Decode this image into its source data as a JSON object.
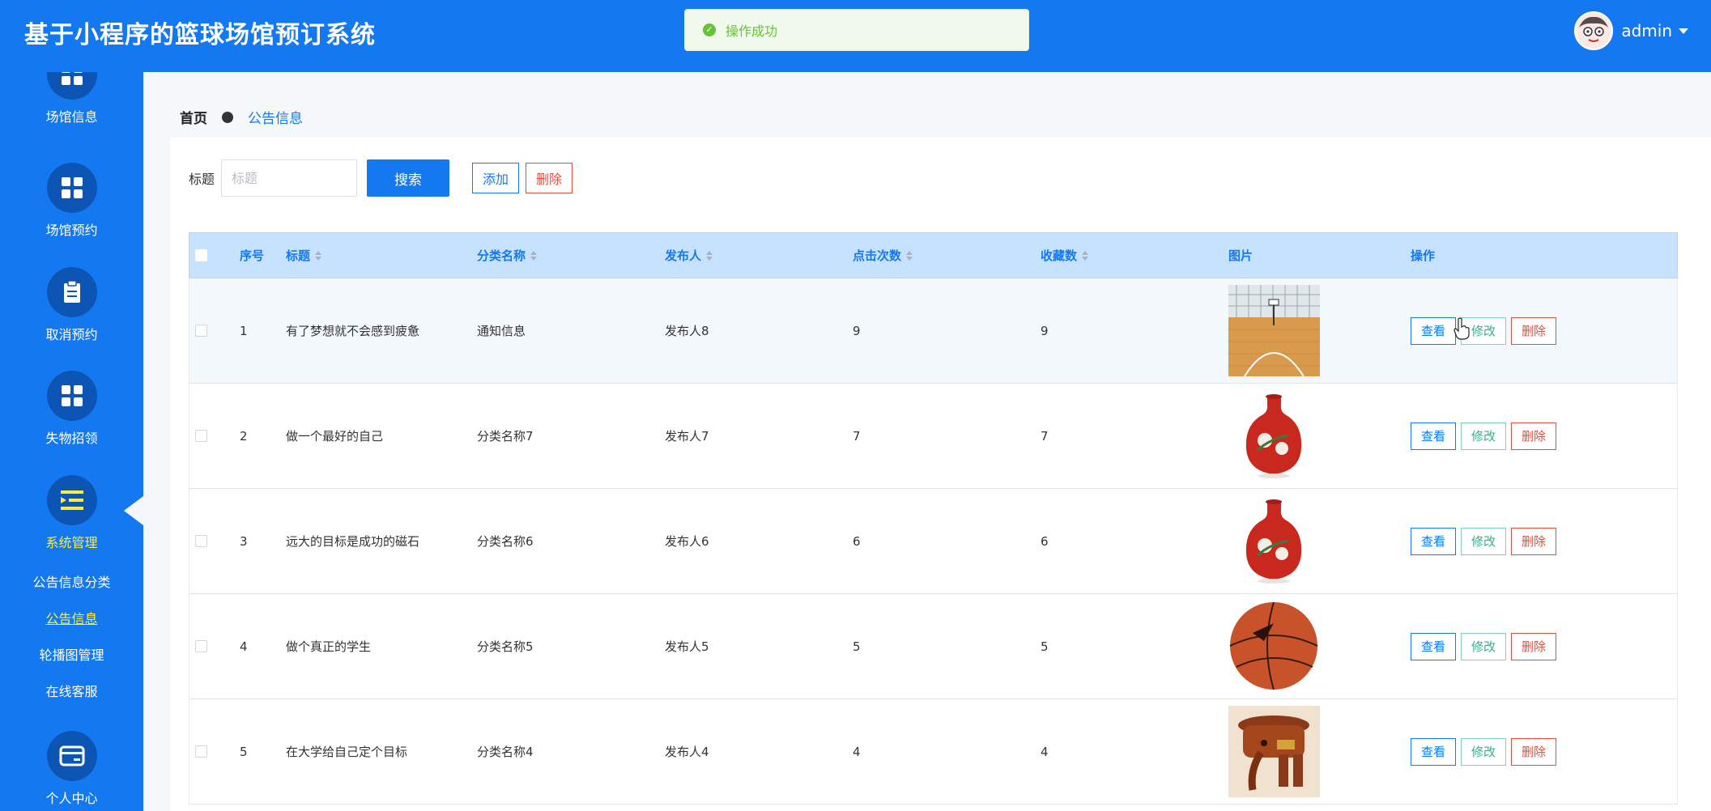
{
  "header": {
    "title": "基于小程序的篮球场馆预订系统",
    "toast": "操作成功",
    "user": "admin"
  },
  "sidebar": {
    "items": [
      {
        "label": "场馆信息",
        "icon": "grid-icon"
      },
      {
        "label": "场馆预约",
        "icon": "grid-icon"
      },
      {
        "label": "取消预约",
        "icon": "clipboard-icon"
      },
      {
        "label": "失物招领",
        "icon": "grid-icon"
      },
      {
        "label": "系统管理",
        "icon": "menu-fold-icon",
        "active": true
      },
      {
        "label": "个人中心",
        "icon": "wallet-icon"
      }
    ],
    "sub_items": [
      {
        "label": "公告信息分类"
      },
      {
        "label": "公告信息",
        "active": true
      },
      {
        "label": "轮播图管理"
      },
      {
        "label": "在线客服"
      }
    ]
  },
  "breadcrumb": {
    "home": "首页",
    "current": "公告信息"
  },
  "search": {
    "label": "标题",
    "placeholder": "标题",
    "search_button": "搜索",
    "add_button": "添加",
    "delete_button": "删除"
  },
  "table": {
    "columns": [
      "序号",
      "标题",
      "分类名称",
      "发布人",
      "点击次数",
      "收藏数",
      "图片",
      "操作"
    ],
    "rows": [
      {
        "index": "1",
        "title": "有了梦想就不会感到疲惫",
        "category": "通知信息",
        "publisher": "发布人8",
        "clicks": "9",
        "favorites": "9",
        "image": "basketball-court"
      },
      {
        "index": "2",
        "title": "做一个最好的自己",
        "category": "分类名称7",
        "publisher": "发布人7",
        "clicks": "7",
        "favorites": "7",
        "image": "red-vase"
      },
      {
        "index": "3",
        "title": "远大的目标是成功的磁石",
        "category": "分类名称6",
        "publisher": "发布人6",
        "clicks": "6",
        "favorites": "6",
        "image": "red-vase"
      },
      {
        "index": "4",
        "title": "做个真正的学生",
        "category": "分类名称5",
        "publisher": "发布人5",
        "clicks": "5",
        "favorites": "5",
        "image": "basketball"
      },
      {
        "index": "5",
        "title": "在大学给自己定个目标",
        "category": "分类名称4",
        "publisher": "发布人4",
        "clicks": "4",
        "favorites": "4",
        "image": "wooden-elephant"
      }
    ],
    "ops": {
      "view": "查看",
      "edit": "修改",
      "delete": "删除"
    }
  },
  "colors": {
    "primary": "#1479f0",
    "active_menu": "#ffeb3b",
    "success": "#67c23a",
    "danger": "#e74c3c"
  }
}
